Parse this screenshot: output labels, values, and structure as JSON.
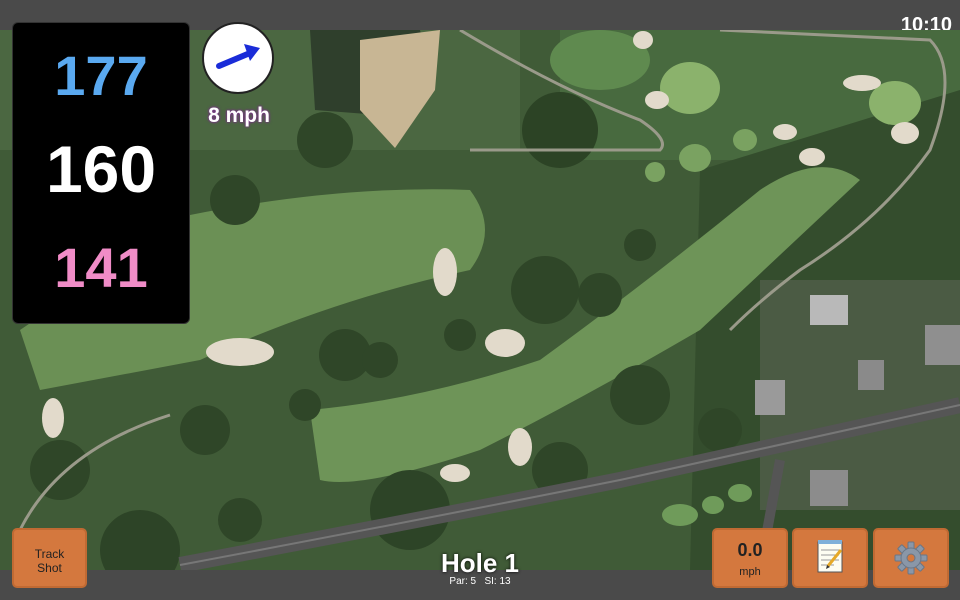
{
  "clock": {
    "time": "10:10"
  },
  "distances": {
    "back": "177",
    "middle": "160",
    "front": "141"
  },
  "wind": {
    "speed_label": "8 mph",
    "direction_icon": "arrow-east-northeast-icon"
  },
  "hole": {
    "title": "Hole 1",
    "par_label": "Par: 5",
    "si_label": "SI: 13"
  },
  "buttons": {
    "track_shot_line1": "Track",
    "track_shot_line2": "Shot",
    "speed_value": "0.0",
    "speed_unit": "mph",
    "notes_icon": "notepad-icon",
    "settings_icon": "gear-icon"
  },
  "colors": {
    "back_distance": "#5aa9f0",
    "middle_distance": "#ffffff",
    "front_distance": "#f08cc7",
    "button_accent": "#d4783e",
    "wind_arrow": "#1a2cd8"
  }
}
